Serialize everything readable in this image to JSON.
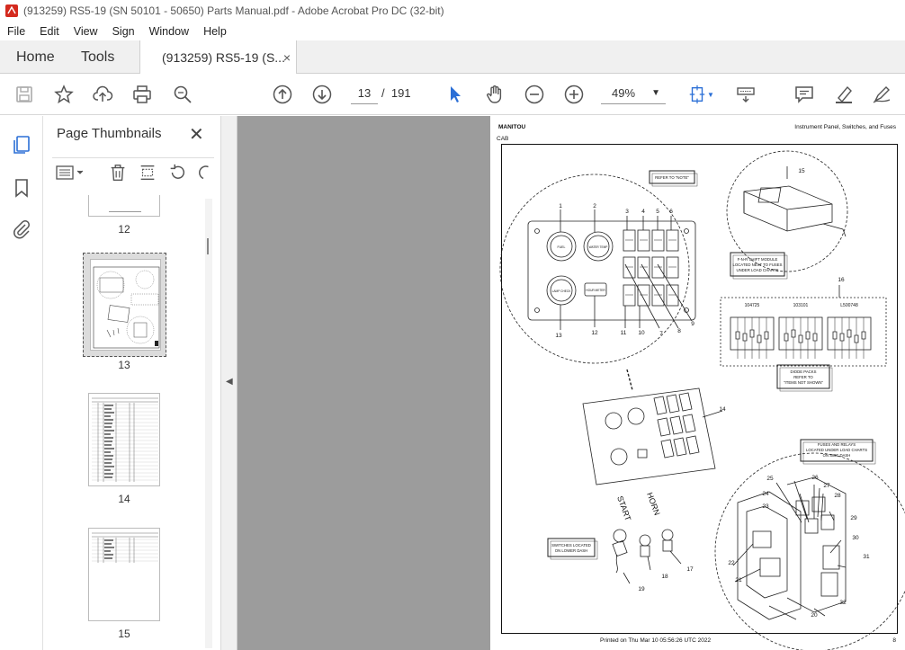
{
  "window": {
    "title": "(913259) RS5-19 (SN 50101 - 50650) Parts Manual.pdf - Adobe Acrobat Pro DC (32-bit)"
  },
  "menu": [
    "File",
    "Edit",
    "View",
    "Sign",
    "Window",
    "Help"
  ],
  "tabs": {
    "home": "Home",
    "tools": "Tools",
    "document": "(913259) RS5-19 (S...",
    "close": "×"
  },
  "toolbar": {
    "current_page": "13",
    "page_separator": "/",
    "total_pages": "191",
    "zoom": "49%"
  },
  "panel": {
    "title": "Page Thumbnails",
    "close": "✕"
  },
  "thumbnails": [
    {
      "label": "12"
    },
    {
      "label": "13",
      "selected": true
    },
    {
      "label": "14"
    },
    {
      "label": "15"
    }
  ],
  "pdf_page": {
    "header_left": "MANITOU",
    "header_sub": "CAB",
    "header_right": "Instrument Panel, Switches, and Fuses",
    "footer_center": "Printed on  Thu Mar 10 05:56:26 UTC 2022",
    "footer_page": "8",
    "callouts": {
      "refer_note": "REFER TO \"NOTE\"",
      "fnr_module_1": "F-N-R SHIFT MODULE",
      "fnr_module_2": "LOCATED NEXT TO FUSES",
      "fnr_module_3": "UNDER LOAD CHARTS",
      "diode_1": "DIODE PACKS",
      "diode_2": "REFER TO",
      "diode_3": "\"ITEMS NOT SHOWN\"",
      "fuses_1": "FUSES AND RELAYS",
      "fuses_2": "LOCATED UNDER LOAD CHARTS",
      "fuses_3": "ON SIDE DASH",
      "switches_1": "SWITCHES LOCATED",
      "switches_2": "ON LOWER DASH",
      "start": "START",
      "horn": "HORN",
      "diode_a": "104725",
      "diode_b": "103101",
      "diode_c": "L500748",
      "gauge_fuel": "FUEL",
      "gauge_water": "WATER TEMP",
      "gauge_lamp": "LAMP CHECK",
      "hour_meter": "HOUR METER"
    },
    "item_numbers": [
      "1",
      "2",
      "3",
      "4",
      "5",
      "6",
      "7",
      "8",
      "9",
      "10",
      "11",
      "12",
      "13",
      "14",
      "15",
      "16",
      "17",
      "18",
      "19",
      "20",
      "21",
      "22",
      "23",
      "24",
      "25",
      "26",
      "27",
      "28",
      "29",
      "30",
      "31",
      "32"
    ]
  },
  "colors": {
    "accent_blue": "#2b6fd6",
    "viewer_gray": "#9c9c9c"
  }
}
